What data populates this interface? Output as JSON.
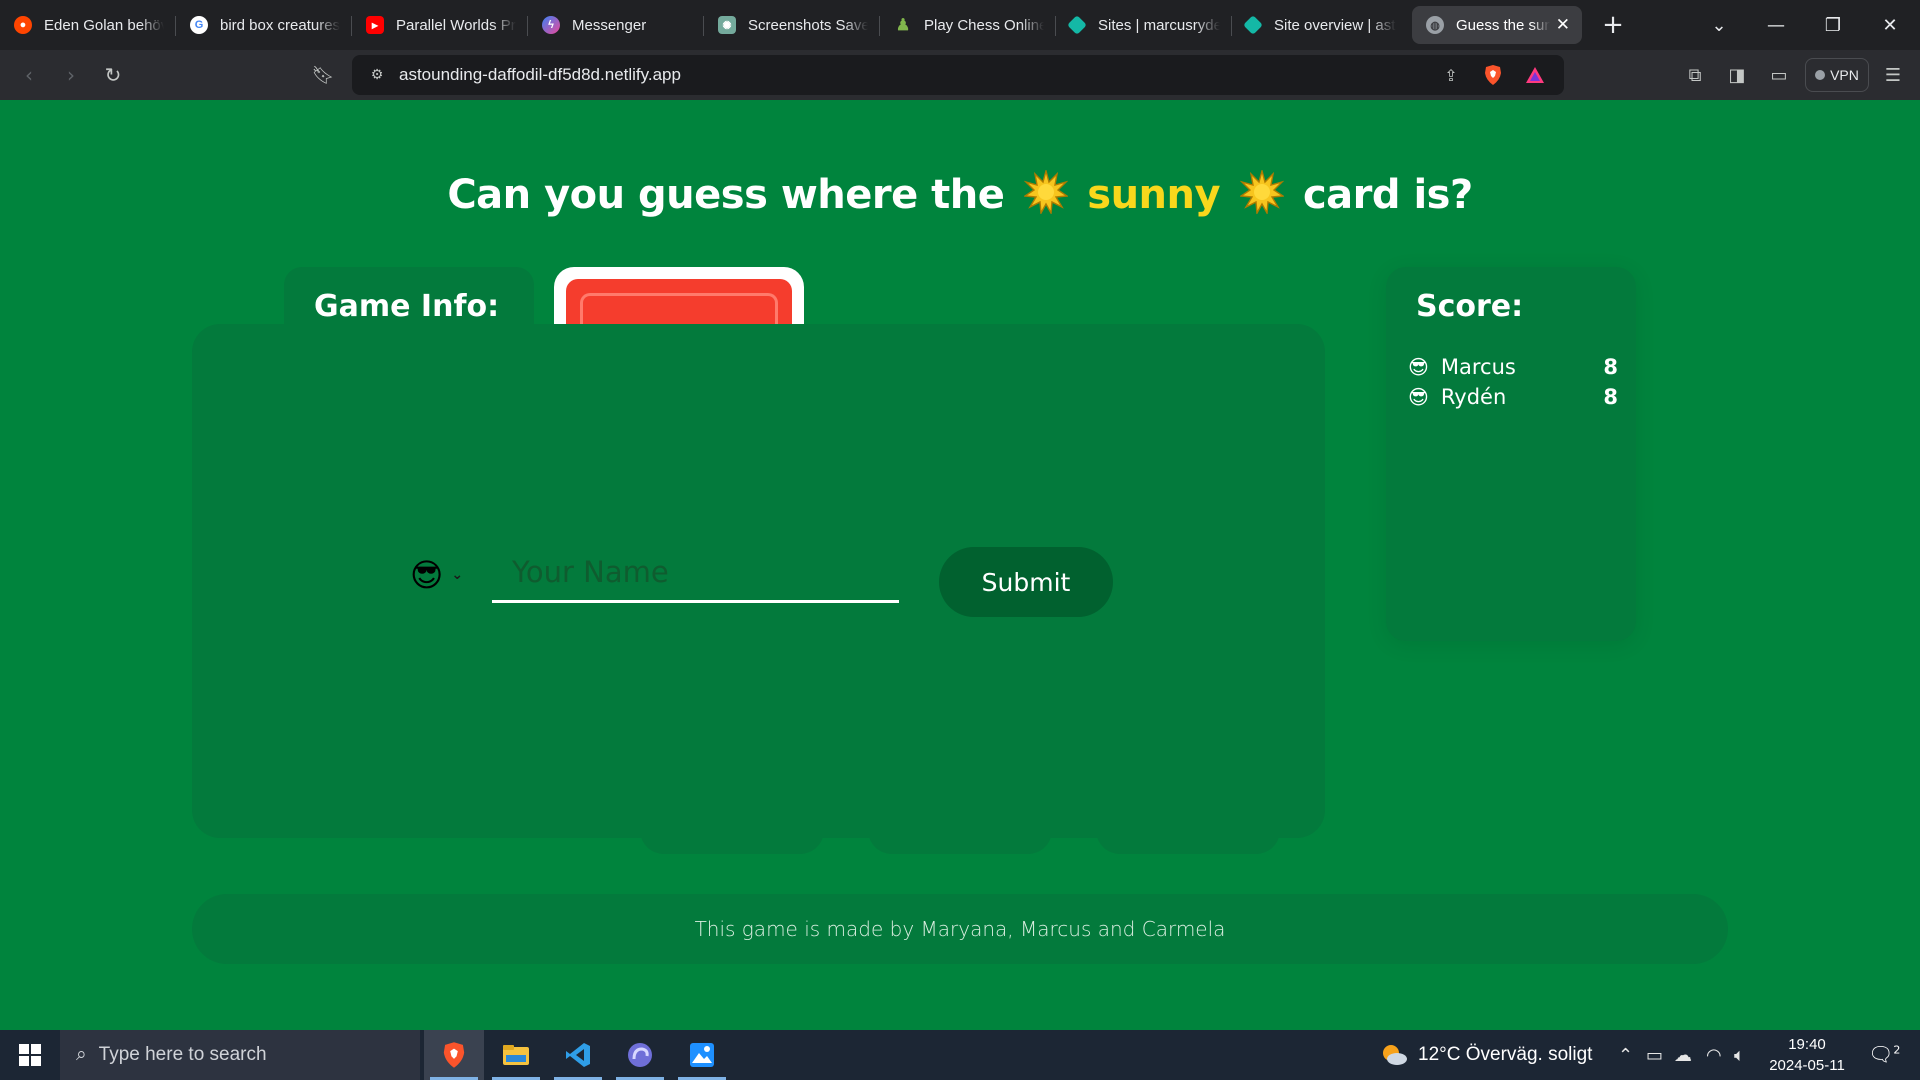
{
  "browser": {
    "tabs": [
      {
        "label": "Eden Golan behöv",
        "icon": "reddit-icon",
        "color": "#ff4500"
      },
      {
        "label": "bird box creatures",
        "icon": "google-icon",
        "color": "#ffffff"
      },
      {
        "label": "Parallel Worlds Pr",
        "icon": "youtube-icon",
        "color": "#ff0000"
      },
      {
        "label": "Messenger",
        "icon": "messenger-icon",
        "color": "#a855f7"
      },
      {
        "label": "Screenshots Saved",
        "icon": "chatgpt-icon",
        "color": "#74aa9c"
      },
      {
        "label": "Play Chess Online",
        "icon": "chess-pawn-icon",
        "color": "#81b64c"
      },
      {
        "label": "Sites | marcusryde",
        "icon": "netlify-icon",
        "color": "#14b8a6"
      },
      {
        "label": "Site overview | ast",
        "icon": "netlify-icon",
        "color": "#14b8a6"
      },
      {
        "label": "Guess the sun",
        "icon": "globe-icon",
        "color": "#9aa0a6",
        "active": true
      }
    ],
    "url": "astounding-daffodil-df5d8d.netlify.app",
    "vpn_label": "VPN"
  },
  "page": {
    "headline_pre": "Can you guess where the",
    "headline_highlight": "sunny",
    "headline_post": "card is?",
    "game_info_title": "Game Info:",
    "name_placeholder": "Your Name",
    "submit_label": "Submit",
    "selected_emoji": "😎",
    "score_title": "Score:",
    "scores": [
      {
        "emoji": "😎",
        "name": "Marcus",
        "points": "8"
      },
      {
        "emoji": "😎",
        "name": "Rydén",
        "points": "8"
      }
    ],
    "footer": "This game is made by Maryana, Marcus and Carmela",
    "colors": {
      "background": "#00843d",
      "panel": "#037a3c",
      "button": "#01612f",
      "highlight": "#f9d71c",
      "card": "#f53d2d"
    }
  },
  "taskbar": {
    "search_placeholder": "Type here to search",
    "weather": "12°C  Överväg. soligt",
    "time": "19:40",
    "date": "2024-05-11",
    "notifications": "2"
  }
}
